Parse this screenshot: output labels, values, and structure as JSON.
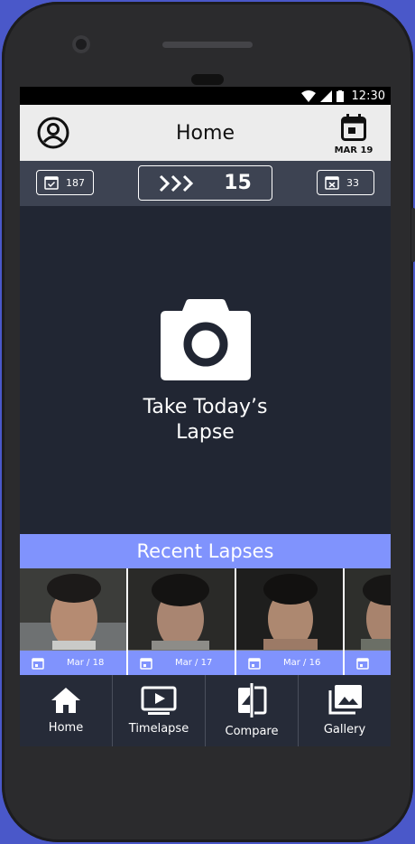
{
  "status_bar": {
    "time": "12:30"
  },
  "app_bar": {
    "title": "Home",
    "date_label": "MAR 19"
  },
  "stats": {
    "completed_count": "187",
    "streak": "15",
    "missed_count": "33"
  },
  "capture": {
    "line1": "Take Today’s",
    "line2": "Lapse"
  },
  "recent": {
    "title": "Recent Lapses",
    "items": [
      {
        "date": "Mar / 18"
      },
      {
        "date": "Mar / 17"
      },
      {
        "date": "Mar / 16"
      },
      {
        "date": ""
      }
    ]
  },
  "nav": {
    "items": [
      {
        "label": "Home",
        "icon": "home-icon"
      },
      {
        "label": "Timelapse",
        "icon": "play-screen-icon"
      },
      {
        "label": "Compare",
        "icon": "compare-icon"
      },
      {
        "label": "Gallery",
        "icon": "gallery-icon"
      }
    ]
  },
  "colors": {
    "accent": "#8093fd",
    "background": "#212633",
    "stats_bar": "#3d4352",
    "nav": "#262b38"
  }
}
